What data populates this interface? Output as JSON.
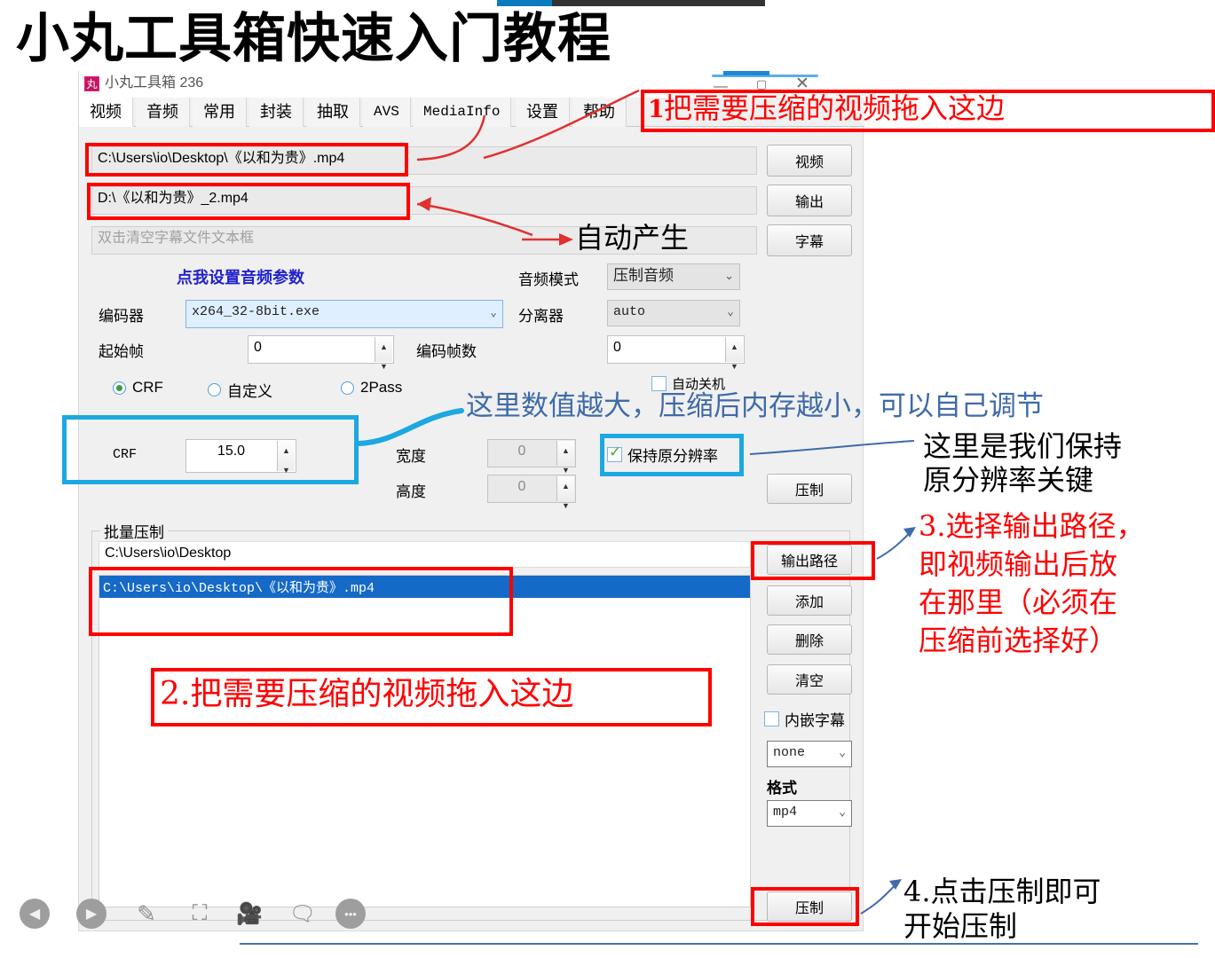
{
  "slide": {
    "title": "小丸工具箱快速入门教程"
  },
  "window": {
    "app_icon_glyph": "丸",
    "title": "小丸工具箱 236",
    "minimize_label": "—",
    "maximize_label": "▢",
    "close_label": "✕"
  },
  "tabs": [
    {
      "label": "视频",
      "active": true,
      "mono": false
    },
    {
      "label": "音频",
      "active": false,
      "mono": false
    },
    {
      "label": "常用",
      "active": false,
      "mono": false
    },
    {
      "label": "封装",
      "active": false,
      "mono": false
    },
    {
      "label": "抽取",
      "active": false,
      "mono": false
    },
    {
      "label": "AVS",
      "active": false,
      "mono": true
    },
    {
      "label": "MediaInfo",
      "active": false,
      "mono": true
    },
    {
      "label": "设置",
      "active": false,
      "mono": false
    },
    {
      "label": "帮助",
      "active": false,
      "mono": false
    }
  ],
  "paths": {
    "video_value": "C:\\Users\\io\\Desktop\\《以和为贵》.mp4",
    "video_button": "视频",
    "output_value": "D:\\《以和为贵》_2.mp4",
    "output_button": "输出",
    "subtitle_placeholder": "双击清空字幕文件文本框",
    "subtitle_button": "字幕"
  },
  "audio": {
    "link_label": "点我设置音频参数",
    "mode_label": "音频模式",
    "mode_value": "压制音频"
  },
  "encoder": {
    "label": "编码器",
    "value": "x264_32-8bit.exe",
    "demuxer_label": "分离器",
    "demuxer_value": "auto",
    "start_frame_label": "起始帧",
    "start_frame_value": "0",
    "frame_count_label": "编码帧数",
    "frame_count_value": "0"
  },
  "modes": {
    "crf": "CRF",
    "custom": "自定义",
    "twopass": "2Pass",
    "selected": "CRF",
    "auto_shutdown": "自动关机",
    "auto_shutdown_checked": false
  },
  "crf": {
    "label": "CRF",
    "value": "15.0",
    "width_label": "宽度",
    "width_value": "0",
    "height_label": "高度",
    "height_value": "0",
    "keep_resolution_label": "保持原分辨率",
    "keep_resolution_checked": true,
    "compress_button": "压制"
  },
  "batch": {
    "group_label": "批量压制",
    "folder_value": "C:\\Users\\io\\Desktop",
    "items": [
      "C:\\Users\\io\\Desktop\\《以和为贵》.mp4"
    ],
    "buttons": [
      {
        "name": "output-path",
        "label": "输出路径"
      },
      {
        "name": "add",
        "label": "添加"
      },
      {
        "name": "delete",
        "label": "删除"
      },
      {
        "name": "clear",
        "label": "清空"
      }
    ],
    "embed_subtitle_label": "内嵌字幕",
    "embed_subtitle_checked": false,
    "subtitle_select_value": "none",
    "format_label": "格式",
    "format_value": "mp4",
    "compress_button": "压制"
  },
  "annotations": {
    "step1": "1.把需要压缩的视频拖入这边",
    "step1_number": "1",
    "step1_text": "把需要压缩的视频拖入这边",
    "auto_generate": "自动产生",
    "crf_hint": "这里数值越大，压缩后内存越小，可以自己调节",
    "keep_res_line1": "这里是我们保持",
    "keep_res_line2": "原分辨率关键",
    "step3_line1": "3.选择输出路径，",
    "step3_line2": "即视频输出后放",
    "step3_line3": "在那里（必须在",
    "step3_line4": "压缩前选择好）",
    "step2": "2.把需要压缩的视频拖入这边",
    "step4_line1": "4.点击压制即可",
    "step4_line2": "开始压制"
  },
  "bottom_toolbar": {
    "icons": [
      {
        "name": "prev-slide-icon",
        "glyph": "◀"
      },
      {
        "name": "next-slide-icon",
        "glyph": "▶"
      },
      {
        "name": "pen-icon",
        "glyph": "✎"
      },
      {
        "name": "spotlight-icon",
        "glyph": "◉"
      },
      {
        "name": "camera-icon",
        "glyph": "▬"
      },
      {
        "name": "comment-icon",
        "glyph": "▤"
      },
      {
        "name": "more-icon",
        "glyph": "•••"
      }
    ]
  },
  "colors": {
    "annotation_red": "#ff0000",
    "annotation_blue": "#1ca8e0",
    "text_blue": "#3f6ba8",
    "selection_blue": "#1569c7",
    "accent_blue": "#0b7bc1"
  }
}
